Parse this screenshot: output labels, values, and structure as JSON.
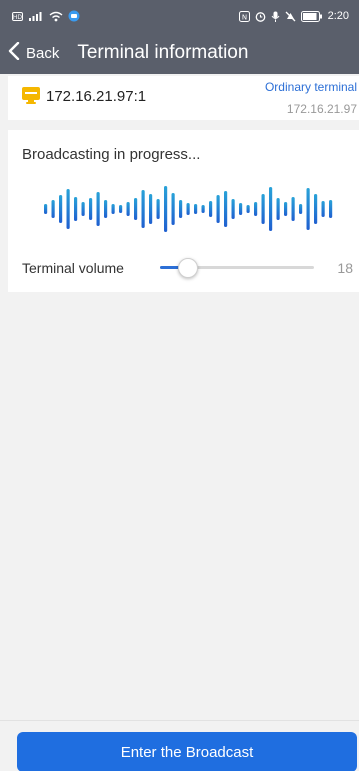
{
  "status_bar": {
    "time": "2:20",
    "left_icons": [
      "hd-icon",
      "signal-icon",
      "wifi-icon",
      "app-notification-icon"
    ],
    "right_icons": [
      "nfc-icon",
      "alarm-icon",
      "mic-icon",
      "mute-icon",
      "battery-icon"
    ],
    "battery_level": "77"
  },
  "nav": {
    "back_label": "Back",
    "title": "Terminal information"
  },
  "terminal": {
    "ip_port": "172.16.21.97:1",
    "type": "Ordinary terminal",
    "ip": "172.16.21.97",
    "icon_color": "#f5b700"
  },
  "broadcast": {
    "status": "Broadcasting in progress...",
    "volume_label": "Terminal volume",
    "volume_value": "18",
    "volume_fraction": 0.18,
    "wave_color_top": "#29a3d8",
    "wave_color_bottom": "#1f5fd0"
  },
  "footer": {
    "button_label": "Enter the Broadcast",
    "button_color": "#1f6ee0"
  }
}
